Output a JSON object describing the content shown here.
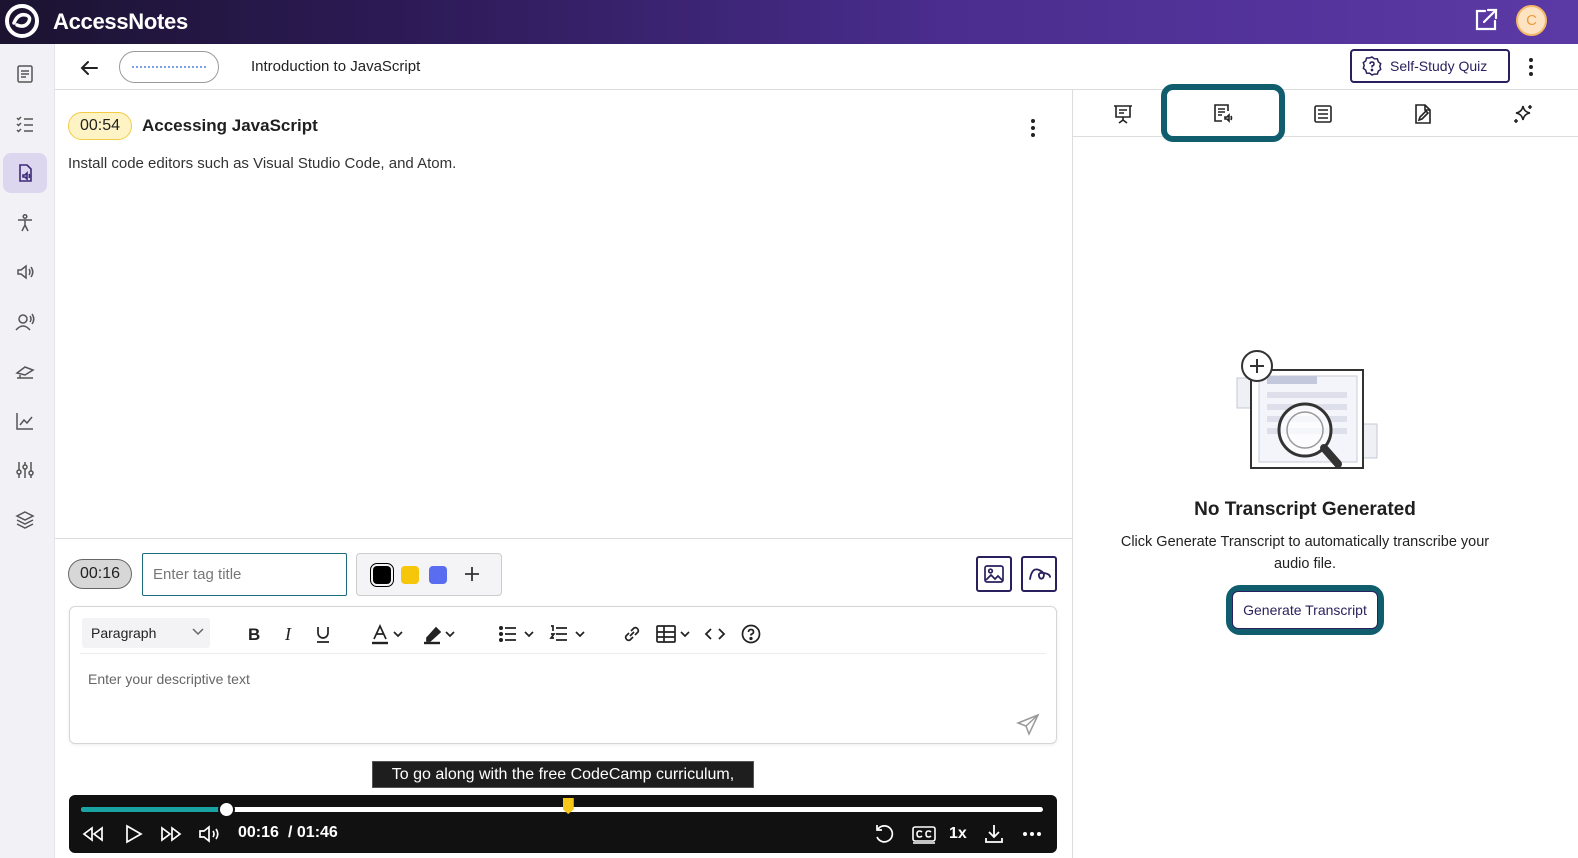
{
  "app": {
    "name": "AccessNotes",
    "avatar_initial": "C"
  },
  "header": {
    "course_title": "Introduction to JavaScript",
    "quiz_label": "Self-Study Quiz"
  },
  "note": {
    "time": "00:54",
    "title": "Accessing JavaScript",
    "description": "Install code editors such as Visual Studio Code, and Atom."
  },
  "composer": {
    "tag_time": "00:16",
    "tag_placeholder": "Enter tag title",
    "colors": [
      "#000000",
      "#f5c60a",
      "#5a6cf0"
    ],
    "selected_color": "#000000",
    "paragraph_style": "Paragraph",
    "text_placeholder": "Enter your descriptive text"
  },
  "player": {
    "caption": "To go along with the free CodeCamp curriculum,",
    "current_time": "00:16",
    "duration": "/ 01:46",
    "speed": "1x",
    "progress_fraction": 0.151,
    "marker_fraction": 0.506
  },
  "panel": {
    "tabs": [
      "slides-icon",
      "transcript-icon",
      "notes-list-icon",
      "edit-document-icon",
      "ai-sparkle-icon"
    ],
    "active_tab": "transcript-icon",
    "empty_title": "No Transcript Generated",
    "empty_desc": "Click Generate Transcript to automatically transcribe your audio file.",
    "generate_label": "Generate Transcript"
  },
  "colors": {
    "brand": "#4a2d8e",
    "accent": "#0f5d6d",
    "primary_dark": "#2a1f5c"
  }
}
